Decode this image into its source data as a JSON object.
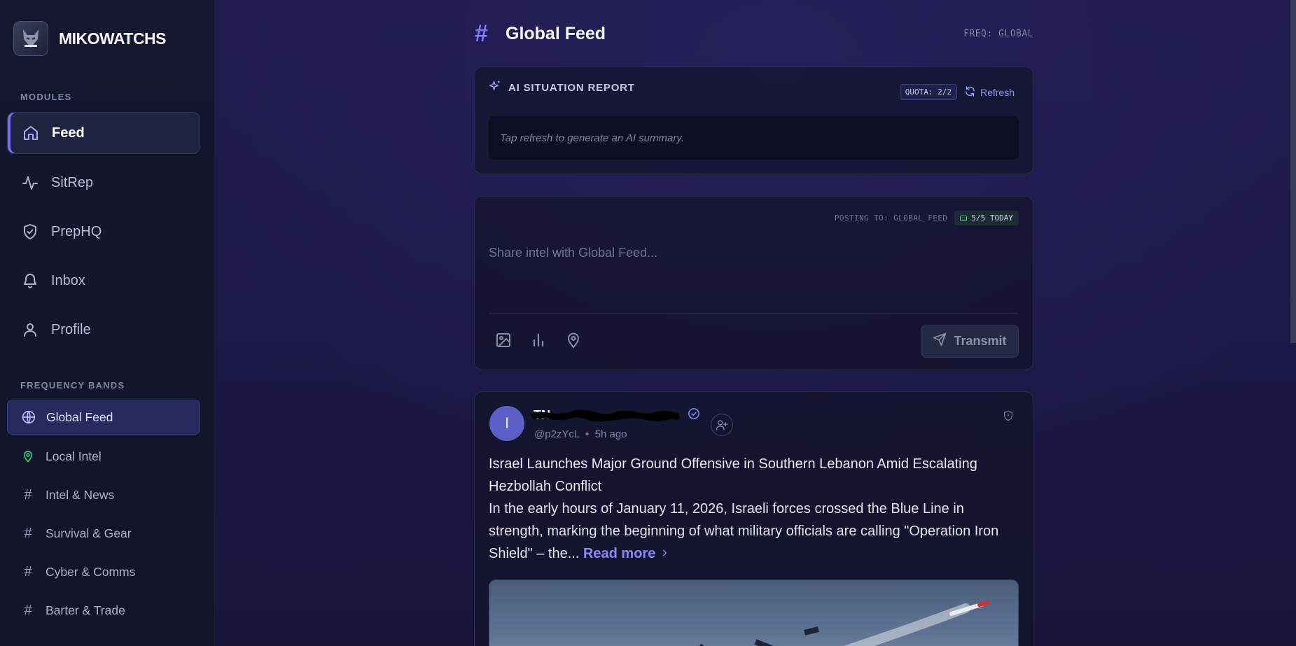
{
  "app": {
    "name": "MIKOWATCHS"
  },
  "sidebar": {
    "modules_label": "MODULES",
    "modules": [
      {
        "label": "Feed",
        "icon": "home-icon",
        "active": true
      },
      {
        "label": "SitRep",
        "icon": "activity-icon"
      },
      {
        "label": "PrepHQ",
        "icon": "shield-check-icon"
      },
      {
        "label": "Inbox",
        "icon": "bell-icon"
      },
      {
        "label": "Profile",
        "icon": "user-icon"
      }
    ],
    "bands_label": "FREQUENCY BANDS",
    "bands": [
      {
        "label": "Global Feed",
        "icon": "globe-icon",
        "active": true
      },
      {
        "label": "Local Intel",
        "icon": "map-pin-icon"
      },
      {
        "label": "Intel & News",
        "icon": "hash-icon"
      },
      {
        "label": "Survival & Gear",
        "icon": "hash-icon"
      },
      {
        "label": "Cyber & Comms",
        "icon": "hash-icon"
      },
      {
        "label": "Barter & Trade",
        "icon": "hash-icon"
      }
    ]
  },
  "header": {
    "hash": "#",
    "title": "Global Feed",
    "freq": "FREQ: GLOBAL"
  },
  "sitrep": {
    "title": "AI SITUATION REPORT",
    "quota": "QUOTA: 2/2",
    "refresh_label": "Refresh",
    "placeholder": "Tap refresh to generate an AI summary."
  },
  "composer": {
    "posting_to": "POSTING TO: GLOBAL FEED",
    "today": "5/5 TODAY",
    "placeholder": "Share intel with Global Feed...",
    "transmit_label": "Transmit"
  },
  "post": {
    "avatar_letter": "I",
    "author_name": "TN",
    "handle": "@p2zYcL",
    "separator": "•",
    "time": "5h ago",
    "title": "Israel Launches Major Ground Offensive in Southern Lebanon Amid Escalating Hezbollah Conflict",
    "body": "In the early hours of January 11, 2026, Israeli forces crossed the Blue Line in strength, marking the beginning of what military officials are calling \"Operation Iron Shield\" – the...",
    "read_more": "Read more"
  },
  "colors": {
    "accent": "#7f7cf6",
    "online": "#2fcf84",
    "avatar": "#5b5fc6"
  }
}
